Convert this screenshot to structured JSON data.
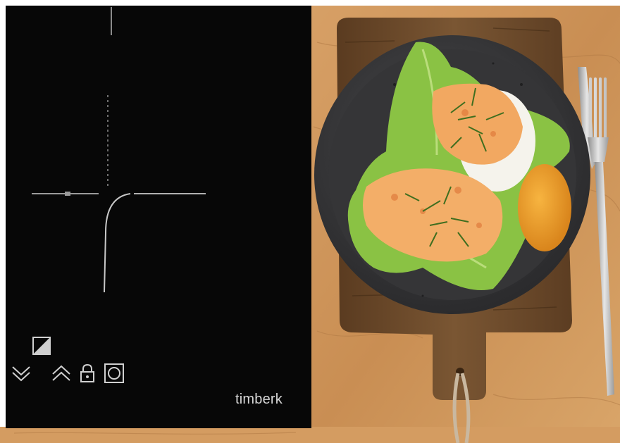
{
  "brand": {
    "logo_text": "timberk"
  },
  "cooktop": {
    "controls": [
      {
        "name": "power-level-icon"
      },
      {
        "name": "decrease-icon"
      },
      {
        "name": "increase-icon"
      },
      {
        "name": "lock-icon"
      },
      {
        "name": "zone-select-icon"
      }
    ]
  },
  "colors": {
    "cooktop_glass": "#070707",
    "table_wood": "#d39a5c",
    "board_wood": "#6a4a2c",
    "plate": "#3a3a3c",
    "lettuce": "#8bc34a",
    "sauce": "#f2a65a",
    "yolk": "#f5a52a",
    "dill": "#3f6e1f"
  }
}
